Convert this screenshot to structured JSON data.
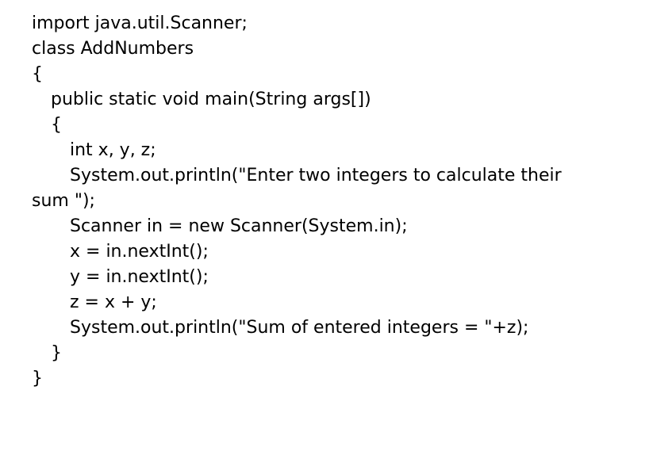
{
  "code": {
    "lines": [
      "import java.util.Scanner;",
      "class AddNumbers",
      "{",
      "public static void main(String args[])",
      "{",
      "int x, y, z;",
      "System.out.println(\"Enter two integers to calculate their",
      "sum \");",
      "Scanner in = new Scanner(System.in);",
      "x = in.nextInt();",
      "y = in.nextInt();",
      "z = x + y;",
      "System.out.println(\"Sum of entered integers = \"+z);",
      "}",
      "}"
    ]
  }
}
